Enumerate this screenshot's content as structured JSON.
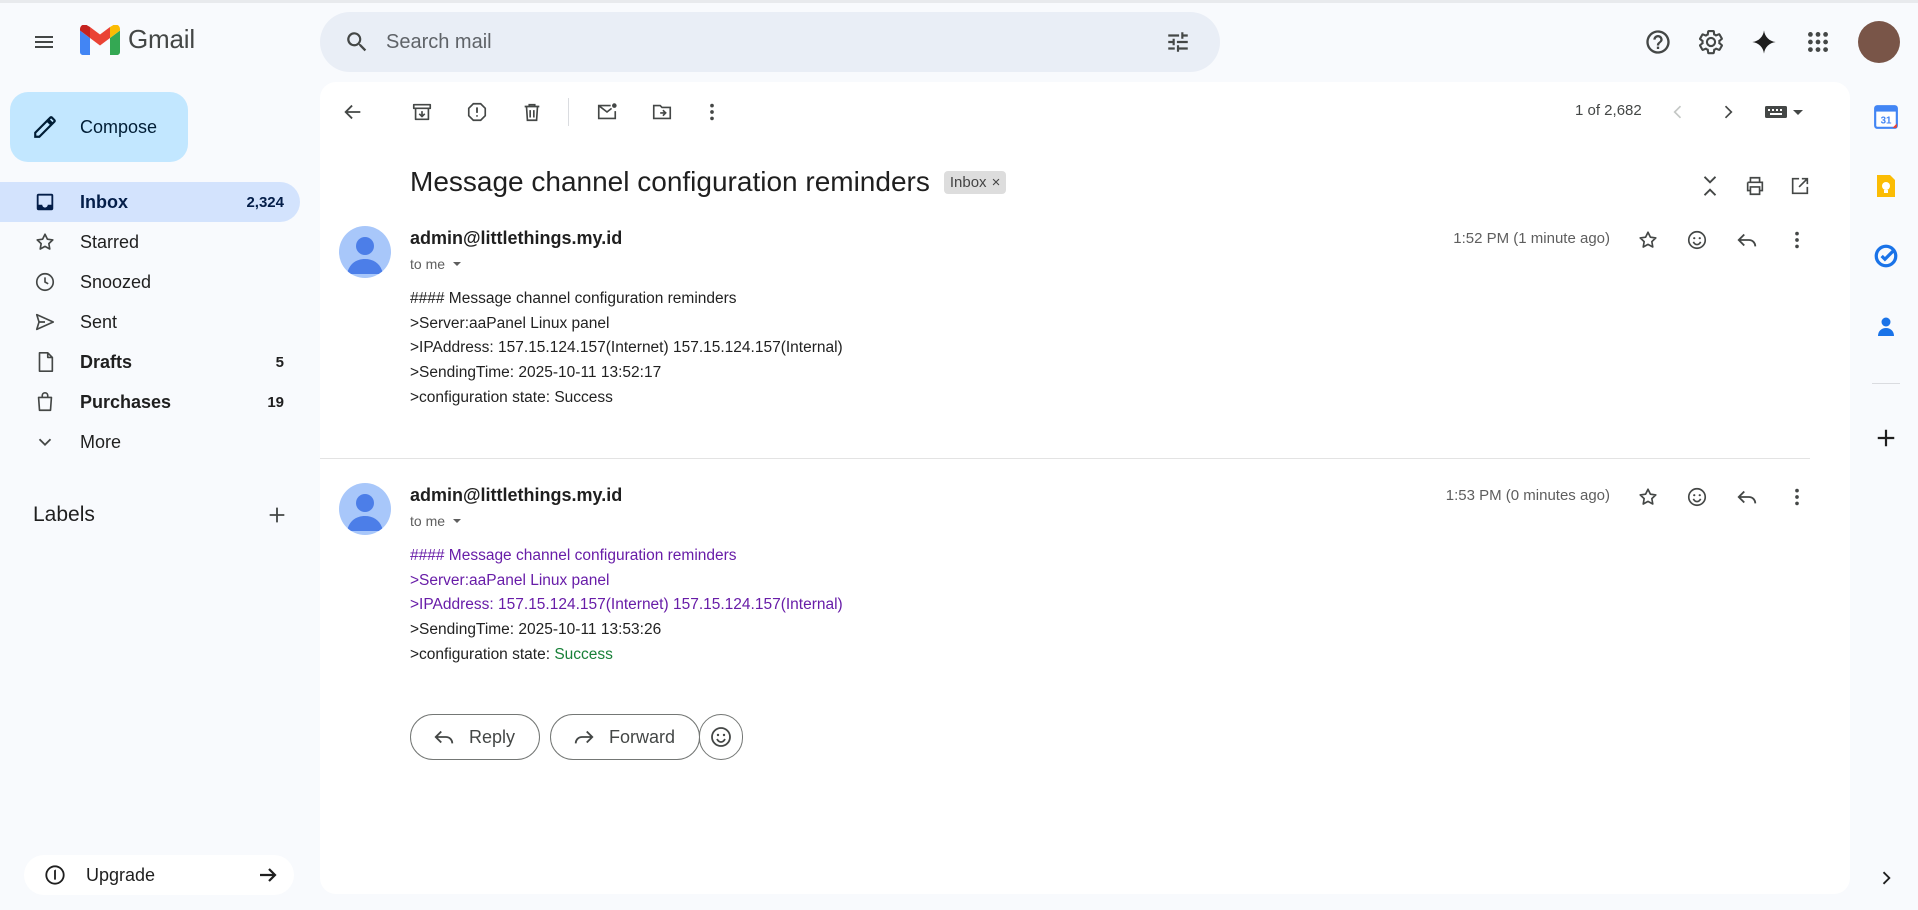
{
  "app": {
    "name": "Gmail"
  },
  "search": {
    "placeholder": "Search mail"
  },
  "compose": {
    "label": "Compose"
  },
  "nav": {
    "items": [
      {
        "label": "Inbox",
        "count": "2,324"
      },
      {
        "label": "Starred",
        "count": ""
      },
      {
        "label": "Snoozed",
        "count": ""
      },
      {
        "label": "Sent",
        "count": ""
      },
      {
        "label": "Drafts",
        "count": "5"
      },
      {
        "label": "Purchases",
        "count": "19"
      },
      {
        "label": "More",
        "count": ""
      }
    ]
  },
  "labels": {
    "title": "Labels"
  },
  "upgrade": {
    "label": "Upgrade"
  },
  "toolbar": {
    "pager": "1 of 2,682"
  },
  "thread": {
    "subject": "Message channel configuration reminders",
    "chip": "Inbox",
    "messages": [
      {
        "sender": "admin@littlethings.my.id",
        "to": "to me",
        "time": "1:52 PM (1 minute ago)",
        "lines": [
          "#### Message channel configuration reminders",
          ">Server:aaPanel Linux panel",
          ">IPAddress: 157.15.124.157(Internet) 157.15.124.157(Internal)",
          ">SendingTime: 2025-10-11 13:52:17",
          ">configuration state: Success"
        ]
      },
      {
        "sender": "admin@littlethings.my.id",
        "to": "to me",
        "time": "1:53 PM (0 minutes ago)",
        "lines": [
          "#### Message channel configuration reminders",
          ">Server:aaPanel Linux panel",
          ">IPAddress: 157.15.124.157(Internet) 157.15.124.157(Internal)",
          ">SendingTime: 2025-10-11 13:53:26"
        ],
        "last_line_prefix": ">configuration state: ",
        "last_line_value": "Success"
      }
    ]
  },
  "actions": {
    "reply": "Reply",
    "forward": "Forward"
  },
  "colors": {
    "accent": "#c2e7ff",
    "active_nav": "#d3e3fd",
    "link_visited": "#681da8",
    "success": "#188038"
  }
}
